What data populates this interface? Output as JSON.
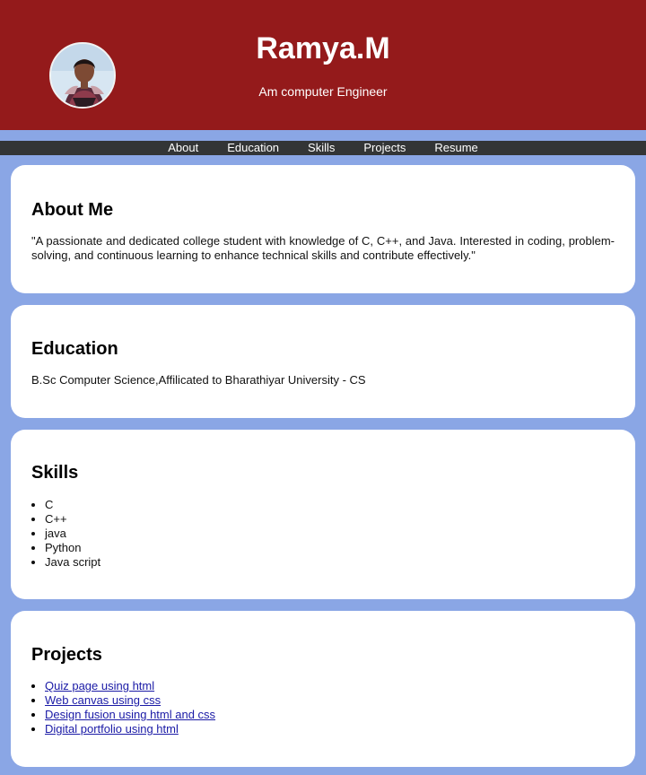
{
  "header": {
    "name": "Ramya.M",
    "tagline": "Am computer Engineer",
    "avatar_icon": "profile-photo",
    "background_color": "#941a1b"
  },
  "nav": {
    "items": [
      "About",
      "Education",
      "Skills",
      "Projects",
      "Resume"
    ]
  },
  "about": {
    "title": "About Me",
    "text": "\"A passionate and dedicated college student with knowledge of C, C++, and Java. Interested in coding, problem-solving, and continuous learning to enhance technical skills and contribute effectively.\""
  },
  "education": {
    "title": "Education",
    "text": "B.Sc Computer Science,Affilicated to Bharathiyar University - CS"
  },
  "skills": {
    "title": "Skills",
    "items": [
      "C",
      "C++",
      "java",
      "Python",
      "Java script"
    ]
  },
  "projects": {
    "title": "Projects",
    "items": [
      "Quiz page using html",
      "Web canvas using css",
      "Design fusion using html and css",
      "Digital portfolio using html"
    ]
  },
  "colors": {
    "page_background": "#8aa6e5",
    "nav_background": "#333536",
    "link": "#1a1aa6"
  }
}
